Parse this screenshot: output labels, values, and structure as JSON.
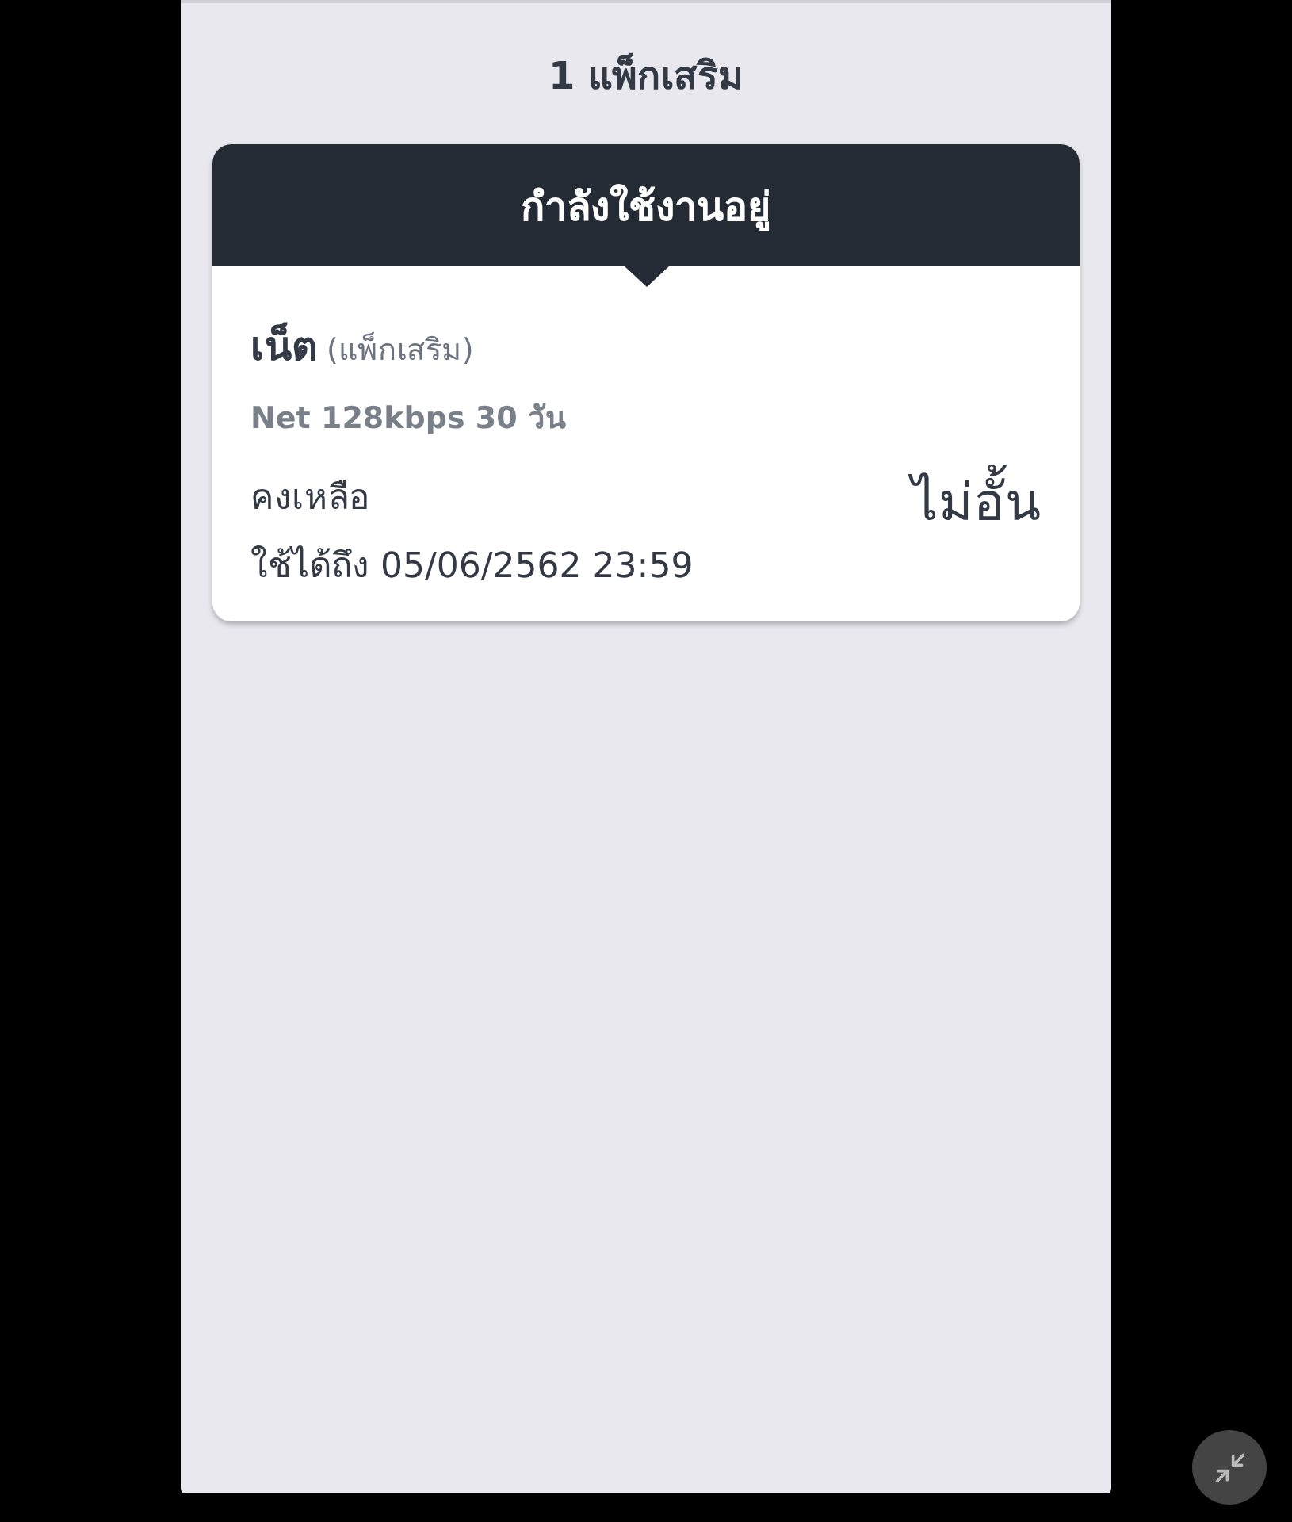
{
  "title": "1 แพ็กเสริม",
  "package_card": {
    "header": "กำลังใช้งานอยู่",
    "name": "เน็ต",
    "name_note": "(แพ็กเสริม)",
    "description": "Net 128kbps 30 วัน",
    "remaining_label": "คงเหลือ",
    "remaining_value": "ไม่อั้น",
    "valid_until": "ใช้ได้ถึง 05/06/2562 23:59"
  }
}
